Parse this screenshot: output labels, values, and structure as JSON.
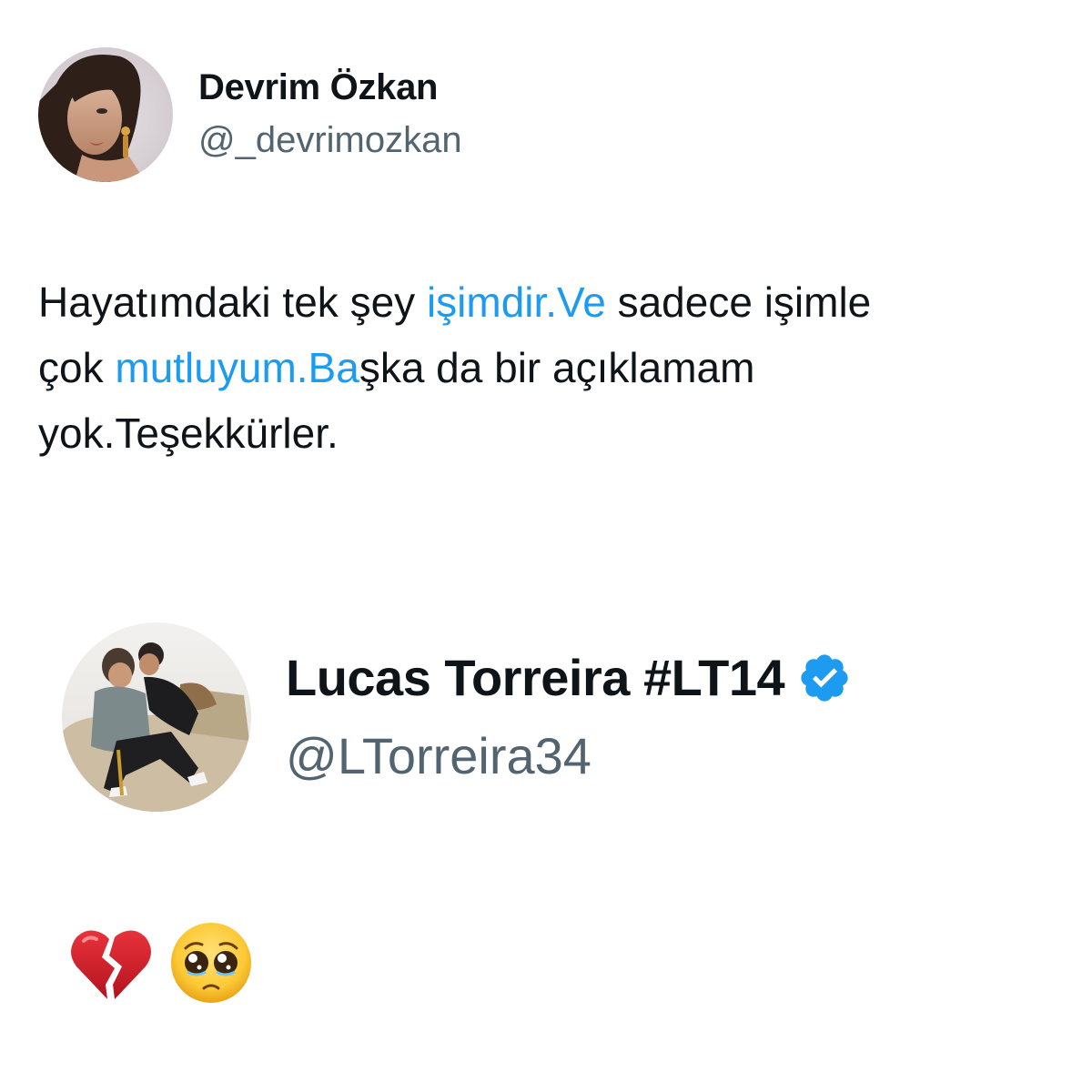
{
  "tweet": {
    "author_name": "Devrim Özkan",
    "author_handle": "@_devrimozkan",
    "avatar_icon": "profile-photo-woman",
    "text_lines": [
      {
        "before": "Hayatımdaki tek şey ",
        "link": "işimdir.Ve",
        "after": " sadece işimle"
      },
      {
        "before": "çok ",
        "link": "mutluyum.Ba",
        "after": "şka da bir açıklamam"
      },
      {
        "before": "yok.Teşekkürler.",
        "link": "",
        "after": ""
      }
    ]
  },
  "reply": {
    "author_name": "Lucas Torreira #LT14",
    "author_handle": "@LTorreira34",
    "verified_icon": "verified-badge-icon",
    "avatar_icon": "profile-photo-couple-on-sofa",
    "emojis": [
      "broken-heart-icon",
      "pleading-face-icon"
    ]
  },
  "colors": {
    "text": "#0f1419",
    "secondary": "#536471",
    "link": "#1d9bf0"
  }
}
